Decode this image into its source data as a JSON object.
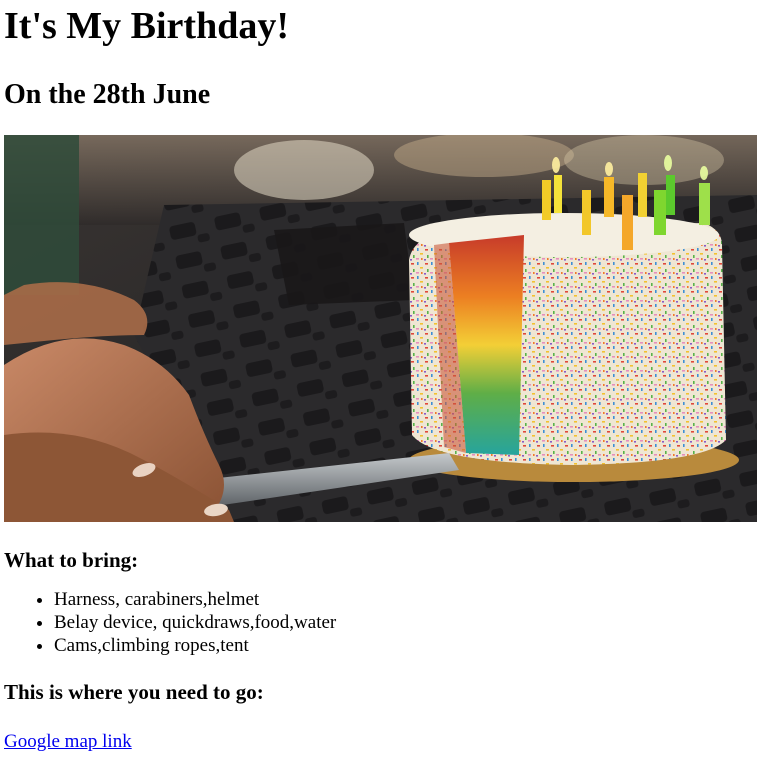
{
  "page": {
    "title": "It's My Birthday!",
    "subtitle": "On the 28th June"
  },
  "hero_image": {
    "alt": "Rainbow birthday cake with sprinkles and candles",
    "colors": {
      "background": "#2e2c2c",
      "frosting": "#f4efe2",
      "rainbow": [
        "#d8432b",
        "#f08a24",
        "#f4d03a",
        "#6cb34a",
        "#2aa7a1"
      ]
    }
  },
  "bring": {
    "heading": "What to bring:",
    "items": [
      "Harness, carabiners,helmet",
      "Belay device, quickdraws,food,water",
      "Cams,climbing ropes,tent"
    ]
  },
  "where": {
    "heading": "This is where you need to go:",
    "link_label": "Google map link"
  }
}
